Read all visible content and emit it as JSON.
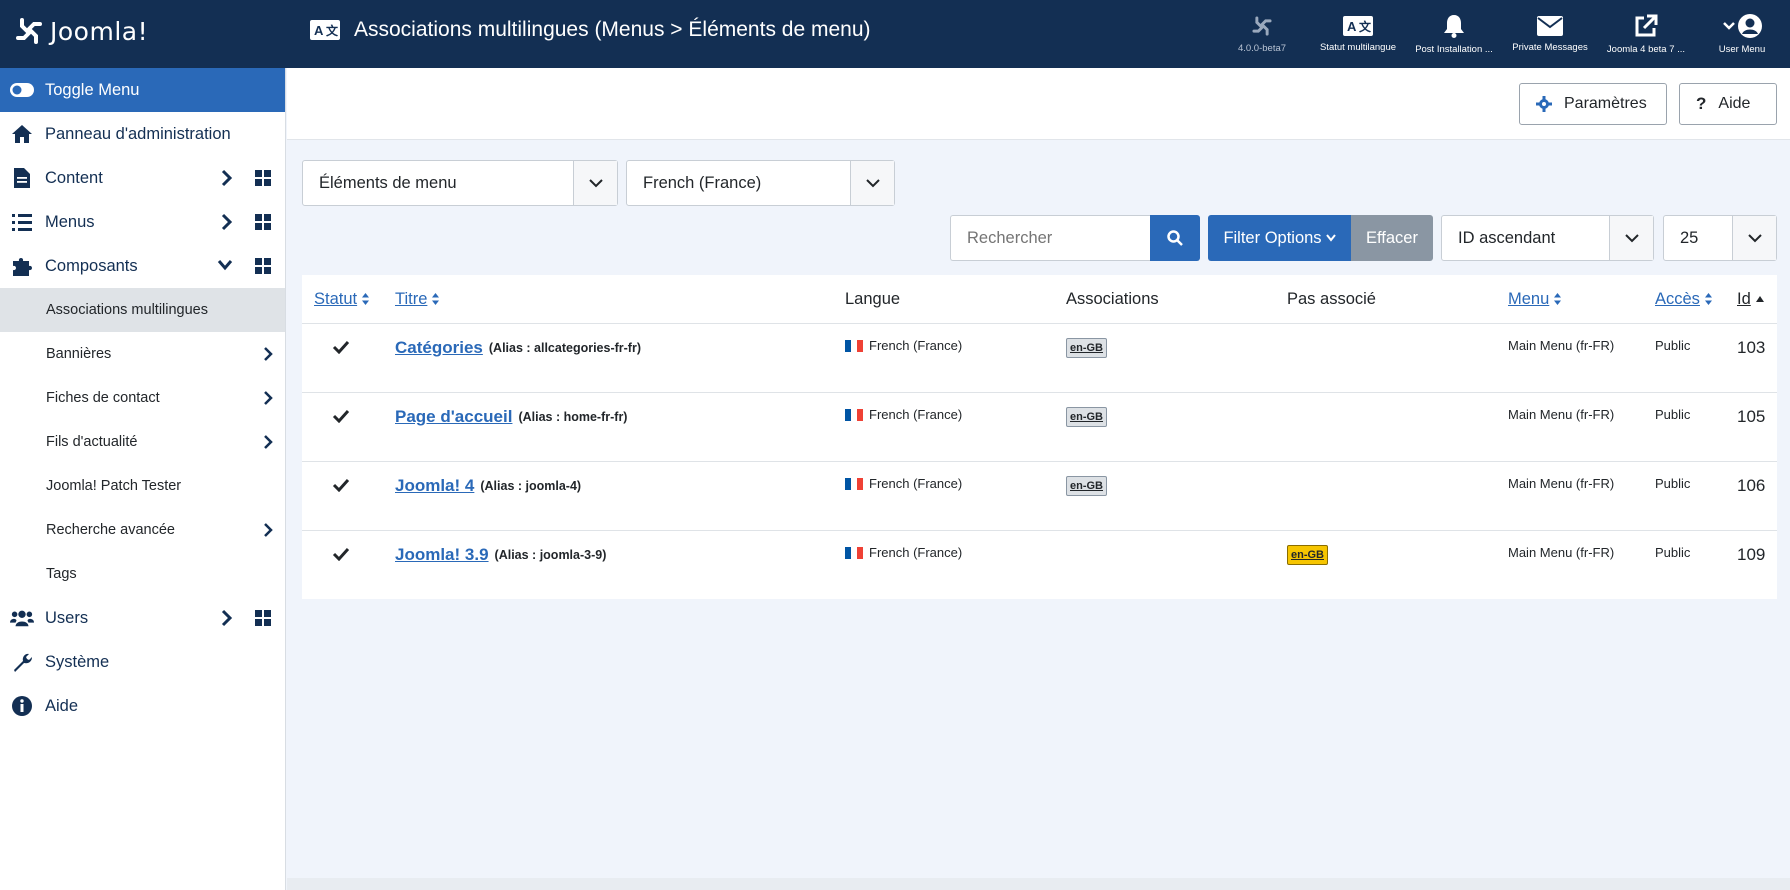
{
  "header": {
    "brand": "Joomla!",
    "title": "Associations multilingues (Menus > Éléments de menu)",
    "tools": [
      {
        "label": "4.0.0-beta7",
        "icon": "joomla-icon",
        "muted": true
      },
      {
        "label": "Statut multilangue",
        "icon": "language-icon",
        "muted": false
      },
      {
        "label": "Post Installation ...",
        "icon": "bell-icon",
        "muted": false
      },
      {
        "label": "Private Messages",
        "icon": "envelope-icon",
        "muted": false
      },
      {
        "label": "Joomla 4 beta 7 ...",
        "icon": "external-link-icon",
        "muted": false
      },
      {
        "label": "User Menu",
        "icon": "user-icon",
        "muted": false
      }
    ]
  },
  "sidebar": {
    "toggle": "Toggle Menu",
    "items": [
      {
        "label": "Panneau d'administration",
        "icon": "home-icon"
      },
      {
        "label": "Content",
        "icon": "file-icon"
      },
      {
        "label": "Menus",
        "icon": "list-icon"
      },
      {
        "label": "Composants",
        "icon": "puzzle-icon"
      }
    ],
    "sub_items": [
      {
        "label": "Associations multilingues"
      },
      {
        "label": "Bannières"
      },
      {
        "label": "Fiches de contact"
      },
      {
        "label": "Fils d'actualité"
      },
      {
        "label": "Joomla! Patch Tester"
      },
      {
        "label": "Recherche avancée"
      },
      {
        "label": "Tags"
      }
    ],
    "bottom_items": [
      {
        "label": "Users",
        "icon": "users-icon"
      },
      {
        "label": "Système",
        "icon": "wrench-icon"
      },
      {
        "label": "Aide",
        "icon": "info-icon"
      }
    ]
  },
  "toolbar": {
    "params_label": "Paramètres",
    "help_label": "Aide"
  },
  "filters": {
    "item_type": "Éléments de menu",
    "language": "French (France)",
    "search_placeholder": "Rechercher",
    "filter_options": "Filter Options",
    "clear": "Effacer",
    "ordering": "ID ascendant",
    "limit": "25"
  },
  "table": {
    "headers": {
      "status": "Statut",
      "title": "Titre",
      "language": "Langue",
      "associations": "Associations",
      "not_associated": "Pas associé",
      "menu": "Menu",
      "access": "Accès",
      "id": "Id"
    },
    "rows": [
      {
        "title": "Catégories",
        "alias": "(Alias : allcategories-fr-fr)",
        "language": "French (France)",
        "association": "en-GB",
        "not_associated": "",
        "menu": "Main Menu (fr-FR)",
        "access": "Public",
        "id": "103"
      },
      {
        "title": "Page d'accueil",
        "alias": "(Alias : home-fr-fr)",
        "language": "French (France)",
        "association": "en-GB",
        "not_associated": "",
        "menu": "Main Menu (fr-FR)",
        "access": "Public",
        "id": "105"
      },
      {
        "title": "Joomla! 4",
        "alias": "(Alias : joomla-4)",
        "language": "French (France)",
        "association": "en-GB",
        "not_associated": "",
        "menu": "Main Menu (fr-FR)",
        "access": "Public",
        "id": "106"
      },
      {
        "title": "Joomla! 3.9",
        "alias": "(Alias : joomla-3-9)",
        "language": "French (France)",
        "association": "",
        "not_associated": "en-GB",
        "menu": "Main Menu (fr-FR)",
        "access": "Public",
        "id": "109"
      }
    ]
  },
  "colors": {
    "header_bg": "#132f53",
    "primary": "#2a69b8",
    "missing_badge": "#f6c500"
  }
}
